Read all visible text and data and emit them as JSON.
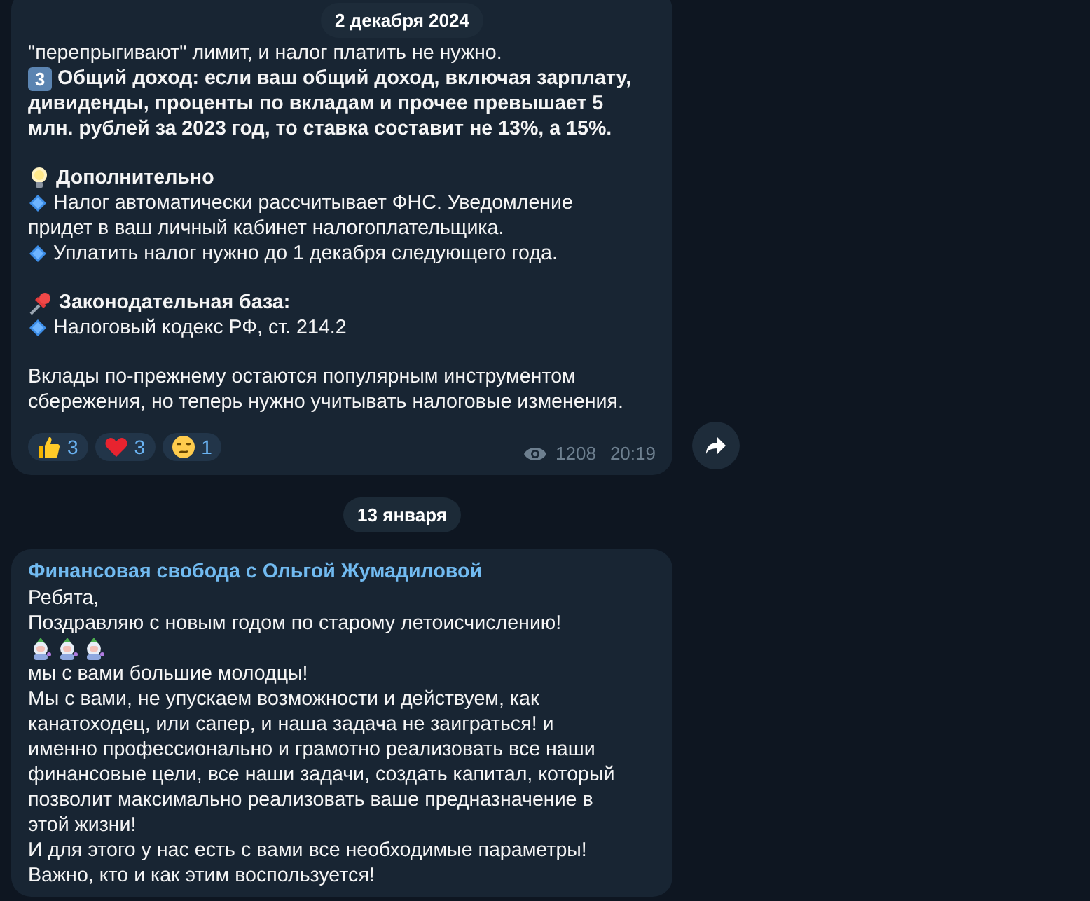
{
  "floating_date": "2 декабря 2024",
  "posts": [
    {
      "lines": [
        {
          "kind": "text",
          "text": "\"перепрыгивают\" лимит, и налог платить не нужно.",
          "bold": false
        },
        {
          "kind": "keycap",
          "key": "3",
          "text": "Общий доход: если ваш общий доход, включая зарплату,",
          "bold": true
        },
        {
          "kind": "text",
          "text": "дивиденды, проценты по вкладам и прочее превышает 5",
          "bold": true
        },
        {
          "kind": "text",
          "text": "млн.  рублей за 2023 год, то ставка составит не 13%, а 15%.",
          "bold": true
        },
        {
          "kind": "blank"
        },
        {
          "kind": "bulb",
          "text": "Дополнительно",
          "bold": true
        },
        {
          "kind": "diamond",
          "text": "Налог автоматически рассчитывает ФНС. Уведомление",
          "bold": false
        },
        {
          "kind": "text",
          "text": "придет в ваш личный кабинет налогоплательщика.",
          "bold": false
        },
        {
          "kind": "diamond",
          "text": "Уплатить налог нужно до 1 декабря следующего года.",
          "bold": false
        },
        {
          "kind": "blank"
        },
        {
          "kind": "pin",
          "text": "Законодательная база:",
          "bold": true
        },
        {
          "kind": "diamond",
          "text": "Налоговый кодекс РФ, ст. 214.2",
          "bold": false
        },
        {
          "kind": "blank"
        },
        {
          "kind": "text",
          "text": "Вклады по-прежнему остаются популярным инструментом",
          "bold": false
        },
        {
          "kind": "text",
          "text": "сбережения, но теперь нужно учитывать налоговые изменения.",
          "bold": false
        }
      ],
      "reactions": [
        {
          "kind": "like",
          "count": "3"
        },
        {
          "kind": "heart",
          "count": "3"
        },
        {
          "kind": "woozy",
          "count": "1"
        }
      ],
      "views": "1208",
      "time": "20:19",
      "forward": true
    },
    {
      "date_before": "13 января",
      "author": "Финансовая свобода с Ольгой Жумадиловой",
      "lines": [
        {
          "kind": "text",
          "text": "Ребята,",
          "bold": false
        },
        {
          "kind": "text",
          "text": "Поздравляю с новым годом по старому летоисчислению!",
          "bold": false
        },
        {
          "kind": "emoji_row",
          "emoji": [
            {
              "kind": "santa"
            },
            {
              "kind": "santa"
            },
            {
              "kind": "santa"
            }
          ]
        },
        {
          "kind": "text",
          "text": "мы с вами большие молодцы!",
          "bold": false
        },
        {
          "kind": "text",
          "text": "Мы с вами, не упускаем возможности и действуем, как",
          "bold": false
        },
        {
          "kind": "text",
          "text": "канатоходец, или сапер, и наша задача не заиграться! и",
          "bold": false
        },
        {
          "kind": "text",
          "text": "именно профессионально и грамотно реализовать все наши",
          "bold": false
        },
        {
          "kind": "text",
          "text": "финансовые цели, все наши задачи, создать капитал, который",
          "bold": false
        },
        {
          "kind": "text",
          "text": "позволит максимально реализовать ваше предназначение в",
          "bold": false
        },
        {
          "kind": "text",
          "text": "этой жизни!",
          "bold": false
        },
        {
          "kind": "text",
          "text": "И для этого у нас есть с вами все необходимые параметры!",
          "bold": false
        },
        {
          "kind": "text",
          "text": "Важно, кто  и как этим воспользуется!",
          "bold": false
        }
      ]
    }
  ]
}
